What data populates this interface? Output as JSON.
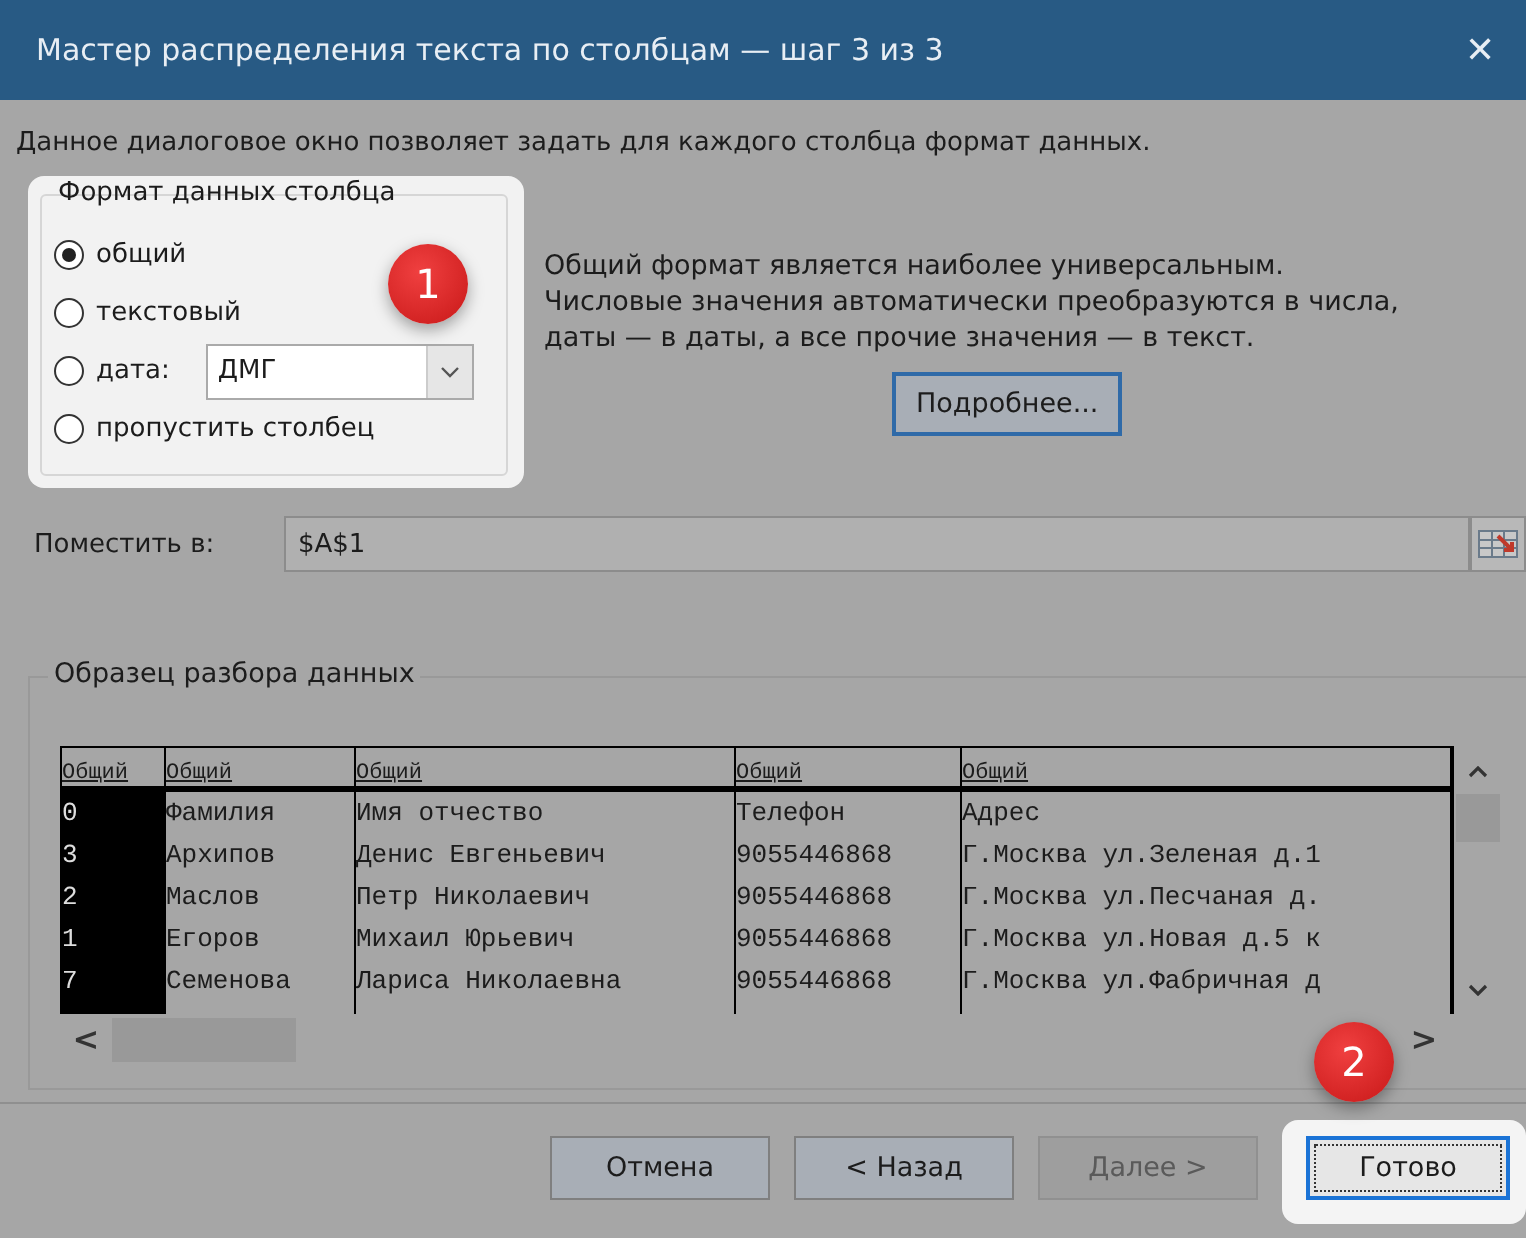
{
  "window": {
    "title": "Мастер распределения текста по столбцам — шаг 3 из 3",
    "close": "✕"
  },
  "intro": "Данное диалоговое окно позволяет задать для каждого столбца формат данных.",
  "format_group": {
    "title": "Формат данных столбца",
    "highlighted": true,
    "options": [
      {
        "label": "общий",
        "selected": true
      },
      {
        "label": "текстовый",
        "selected": false
      },
      {
        "label": "дата:",
        "selected": false
      },
      {
        "label": "пропустить столбец",
        "selected": false
      }
    ],
    "date_dropdown": {
      "value": "ДМГ"
    }
  },
  "callouts": [
    {
      "number": "1"
    },
    {
      "number": "2"
    }
  ],
  "description": [
    "Общий формат является наиболее универсальным.",
    "Числовые значения автоматически преобразуются в числа,",
    "даты — в даты, а все прочие значения — в текст."
  ],
  "details_button": "Подробнее...",
  "destination": {
    "label": "Поместить в:",
    "value": "$A$1"
  },
  "preview": {
    "title": "Образец разбора данных",
    "columns": [
      {
        "header": "Общий",
        "selected": true
      },
      {
        "header": "Общий",
        "selected": false
      },
      {
        "header": "Общий",
        "selected": false
      },
      {
        "header": "Общий",
        "selected": false
      },
      {
        "header": "Общий",
        "selected": false
      }
    ],
    "rows": [
      [
        "0",
        "Фамилия",
        "Имя отчество",
        "Телефон",
        "Адрес"
      ],
      [
        "3",
        "Архипов",
        "Денис Евгеньевич",
        "9055446868",
        "Г.Москва ул.Зеленая д.1"
      ],
      [
        "2",
        "Маслов",
        "Петр Николаевич",
        "9055446868",
        "Г.Москва ул.Песчаная д."
      ],
      [
        "1",
        "Егоров",
        "Михаил Юрьевич",
        "9055446868",
        "Г.Москва ул.Новая д.5 к"
      ],
      [
        "7",
        "Семенова",
        "Лариса Николаевна",
        "9055446868",
        "Г.Москва ул.Фабричная д"
      ]
    ],
    "scroll_left": "<",
    "scroll_right": ">"
  },
  "buttons": [
    {
      "label": "Отмена",
      "disabled": false,
      "default": false,
      "highlighted": false
    },
    {
      "label": "< Назад",
      "disabled": false,
      "default": false,
      "highlighted": false
    },
    {
      "label": "Далее >",
      "disabled": true,
      "default": false,
      "highlighted": false
    },
    {
      "label": "Готово",
      "disabled": false,
      "default": true,
      "highlighted": true
    }
  ]
}
